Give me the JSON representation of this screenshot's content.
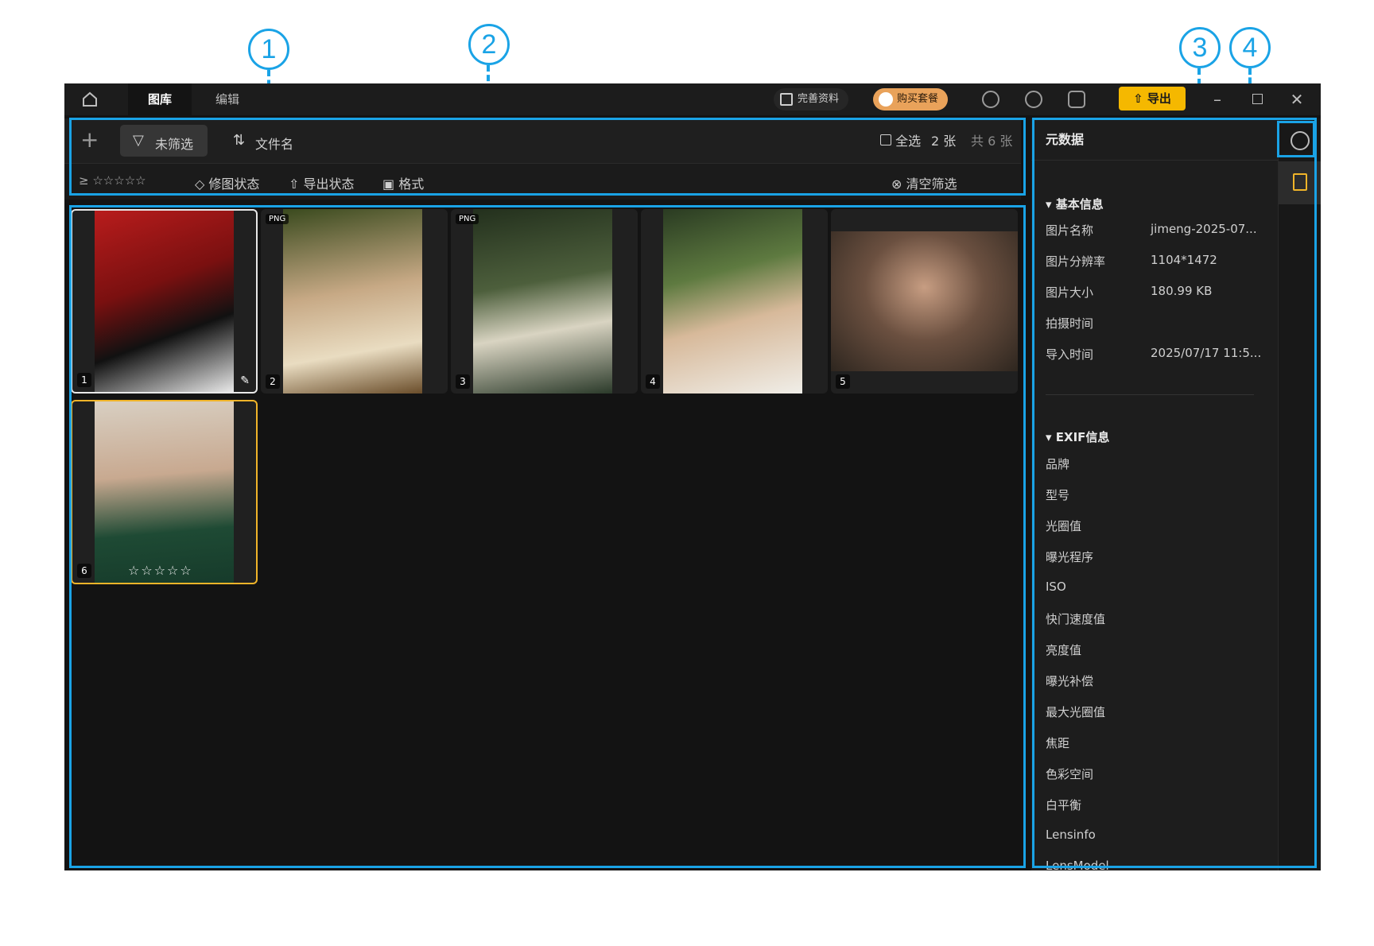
{
  "callouts": [
    "1",
    "2",
    "3",
    "4"
  ],
  "titlebar": {
    "tabs": [
      "图库",
      "编辑"
    ],
    "complete_profile": "完善资料",
    "buy_plan": "购买套餐",
    "export": "导出"
  },
  "toolbar": {
    "filter_label": "未筛选",
    "sort_label": "文件名",
    "select_all": "全选",
    "selected_count": "2 张",
    "total_count": "共 6 张",
    "rating_prefix": "≥",
    "retouch_status": "修图状态",
    "export_status": "导出状态",
    "format": "格式",
    "clear_filter": "清空筛选"
  },
  "grid": {
    "items": [
      {
        "num": "1",
        "tag": ""
      },
      {
        "num": "2",
        "tag": "PNG"
      },
      {
        "num": "3",
        "tag": "PNG"
      },
      {
        "num": "4",
        "tag": ""
      },
      {
        "num": "5",
        "tag": ""
      },
      {
        "num": "6",
        "tag": "",
        "rating_stars": "☆☆☆☆☆"
      }
    ]
  },
  "metadata": {
    "title": "元数据",
    "basic_section": "基本信息",
    "basic": [
      {
        "label": "图片名称",
        "value": "jimeng-2025-07..."
      },
      {
        "label": "图片分辨率",
        "value": "1104*1472"
      },
      {
        "label": "图片大小",
        "value": "180.99 KB"
      },
      {
        "label": "拍摄时间",
        "value": ""
      },
      {
        "label": "导入时间",
        "value": "2025/07/17 11:5..."
      }
    ],
    "exif_section": "EXIF信息",
    "exif": [
      "品牌",
      "型号",
      "光圈值",
      "曝光程序",
      "ISO",
      "快门速度值",
      "亮度值",
      "曝光补偿",
      "最大光圈值",
      "焦距",
      "色彩空间",
      "白平衡",
      "Lensinfo",
      "LensModel"
    ]
  },
  "colors": {
    "accent": "#1aa3e6",
    "export_btn": "#f5b800",
    "buy_btn": "#e9a25a",
    "selected_border": "#f0b429"
  }
}
